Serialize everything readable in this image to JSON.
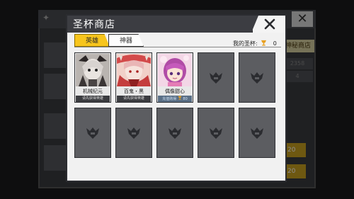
{
  "background": {
    "shop_button": "神秘商店",
    "box1": "2358",
    "box2": "4",
    "yellow1": "20",
    "yellow2": "20"
  },
  "dialog": {
    "title": "圣杯商店",
    "tabs": [
      {
        "label": "英雄",
        "active": true
      },
      {
        "label": "神器",
        "active": false
      }
    ],
    "grail_label": "我的圣杯:",
    "grail_count": "0",
    "heroes": [
      {
        "name": "机械纪元",
        "note": "请先获得英雄",
        "owned": false,
        "art": "mecha"
      },
      {
        "name": "百鬼・黑",
        "note": "请先获得英雄",
        "owned": false,
        "art": "oni"
      },
      {
        "name": "偶像甜心",
        "note": "充值购得",
        "owned": true,
        "art": "idol",
        "price": "80"
      }
    ],
    "empty_slot_icon": "locked-emblem-icon",
    "colors": {
      "accent": "#f7c51c",
      "header": "#3c3d42",
      "slot": "#5c5d61"
    }
  }
}
